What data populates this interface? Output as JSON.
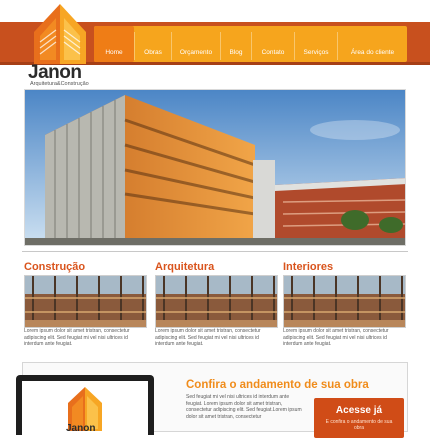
{
  "header": {
    "logo_name": "Janon",
    "logo_tagline": "Arquitetura&Construção",
    "colors": {
      "bar": "#c8501e",
      "nav": "#f6a51d",
      "nav_active": "#ef7d16",
      "accent": "#d9541d"
    }
  },
  "nav": {
    "items": [
      {
        "label": "Home"
      },
      {
        "label": "Obras"
      },
      {
        "label": "Orçamento"
      },
      {
        "label": "Blog"
      },
      {
        "label": "Contato"
      },
      {
        "label": "Serviços"
      },
      {
        "label": "Área do cliente"
      }
    ]
  },
  "columns": [
    {
      "title": "Construção",
      "text": "Lorem ipsum dolor sit amet tristran, consectetur adipiscing elit. Sed feugiat mi vel nisi ultrices id interdum ante feugiat."
    },
    {
      "title": "Arquitetura",
      "text": "Lorem ipsum dolor sit amet tristran, consectetur adipiscing elit. Sed feugiat mi vel nisi ultrices id interdum ante feugiat."
    },
    {
      "title": "Interiores",
      "text": "Lorem ipsum dolor sit amet tristran, consectetur adipiscing elit. Sed feugiat mi vel nisi ultrices id interdum ante feugiat."
    }
  ],
  "footer": {
    "title": "Confira o andamento de sua obra",
    "text": "Sed feugiat mi vel nisi ultrices id interdum ante feugiat. Lorem ipsum dolor sit amet tristran, consectetur adipiscing elit. Sed feugiat.Lorem ipsum dolor sit amet tristran, consectetur",
    "cta_title": "Acesse já",
    "cta_sub": "E confira o andamento de sua obra",
    "monitor_logo": "Janon"
  }
}
